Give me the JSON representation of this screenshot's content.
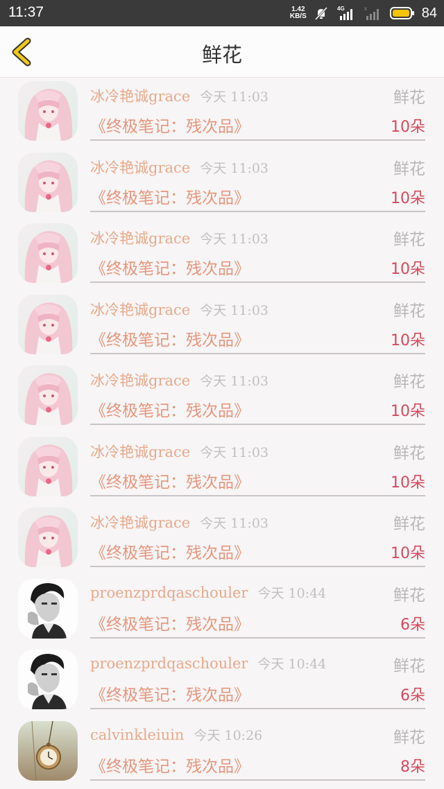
{
  "status_bar": {
    "time": "11:37",
    "net_speed": "1.42",
    "net_unit": "KB/S",
    "signal_label": "4G",
    "battery": "84",
    "battery_color": "#f5c300"
  },
  "header": {
    "title": "鲜花",
    "back_icon": "chevron-left-icon",
    "back_color": "#f0c81a"
  },
  "colors": {
    "name": "#e8a98a",
    "book": "#e7967c",
    "count": "#d6495c",
    "muted": "#b9b6b7"
  },
  "records": [
    {
      "avatar": "anime-girl",
      "name": "冰冷艳诚grace",
      "time": "今天 11:03",
      "gift": "鲜花",
      "book": "《终极笔记：残次品》",
      "count": "10朵"
    },
    {
      "avatar": "anime-girl",
      "name": "冰冷艳诚grace",
      "time": "今天 11:03",
      "gift": "鲜花",
      "book": "《终极笔记：残次品》",
      "count": "10朵"
    },
    {
      "avatar": "anime-girl",
      "name": "冰冷艳诚grace",
      "time": "今天 11:03",
      "gift": "鲜花",
      "book": "《终极笔记：残次品》",
      "count": "10朵"
    },
    {
      "avatar": "anime-girl",
      "name": "冰冷艳诚grace",
      "time": "今天 11:03",
      "gift": "鲜花",
      "book": "《终极笔记：残次品》",
      "count": "10朵"
    },
    {
      "avatar": "anime-girl",
      "name": "冰冷艳诚grace",
      "time": "今天 11:03",
      "gift": "鲜花",
      "book": "《终极笔记：残次品》",
      "count": "10朵"
    },
    {
      "avatar": "anime-girl",
      "name": "冰冷艳诚grace",
      "time": "今天 11:03",
      "gift": "鲜花",
      "book": "《终极笔记：残次品》",
      "count": "10朵"
    },
    {
      "avatar": "anime-girl",
      "name": "冰冷艳诚grace",
      "time": "今天 11:03",
      "gift": "鲜花",
      "book": "《终极笔记：残次品》",
      "count": "10朵"
    },
    {
      "avatar": "bw-man",
      "name": "proenzprdqaschouler",
      "time": "今天 10:44",
      "gift": "鲜花",
      "book": "《终极笔记：残次品》",
      "count": "6朵"
    },
    {
      "avatar": "bw-man",
      "name": "proenzprdqaschouler",
      "time": "今天 10:44",
      "gift": "鲜花",
      "book": "《终极笔记：残次品》",
      "count": "6朵"
    },
    {
      "avatar": "pocket-watch",
      "name": "calvinkleiuin",
      "time": "今天 10:26",
      "gift": "鲜花",
      "book": "《终极笔记：残次品》",
      "count": "8朵"
    }
  ]
}
